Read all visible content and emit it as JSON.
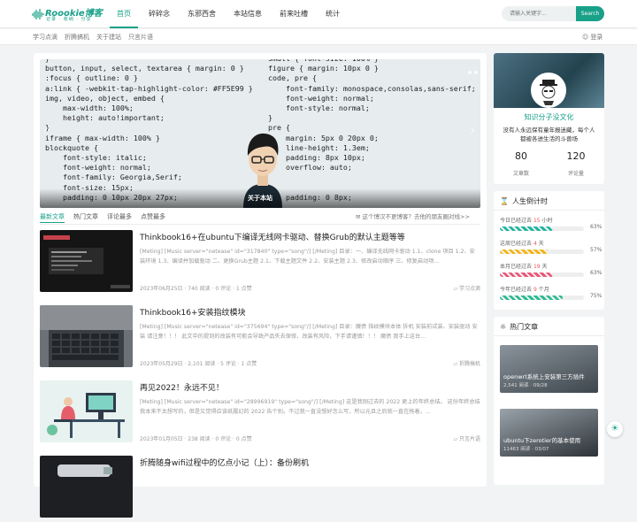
{
  "header": {
    "logo_text": "Roookie博客",
    "logo_slogan": "记录 · 收纳 · 分享",
    "nav": [
      "首页",
      "碎碎念",
      "东邪西舍",
      "本站信息",
      "前来吐槽",
      "统计"
    ],
    "search_placeholder": "请输入关键字...",
    "search_button": "Search"
  },
  "subnav": {
    "links": [
      "学习点滴",
      "折腾搞机",
      "关于建站",
      "只言片语"
    ],
    "login": "登录"
  },
  "hero": {
    "code_left": "}\nbutton, input, select, textarea { margin: 0 }\n:focus { outline: 0 }\na:link { -webkit-tap-highlight-color: #FF5E99 }\nimg, video, object, embed {\n    max-width: 100%;\n    height: auto!important;\n}\niframe { max-width: 100% }\nblockquote {\n    font-style: italic;\n    font-weight: normal;\n    font-family: Georgia,Serif;\n    font-size: 15px;\n    padding: 0 10px 20px 27px;",
    "code_right": "small { font-size: 100% }\nfigure { margin: 10px 0 }\ncode, pre {\n    font-family: monospace,consolas,sans-serif;\n    font-weight: normal;\n    font-style: normal;\n}\npre {\n    margin: 5px 0 20px 0;\n    line-height: 1.3em;\n    padding: 8px 10px;\n    overflow: auto;\n\n\n    padding: 0 8px;",
    "caption": "关于本站"
  },
  "tabs": [
    "最新文章",
    "热门文章",
    "评论最多",
    "点赞最多"
  ],
  "notice": "这个博汉不更博客？去他的朋友圈对线>>",
  "posts": [
    {
      "title": "Thinkbook16+在ubuntu下编译无线网卡驱动、替换Grub的默认主题等等",
      "excerpt": "[Meting] [Music server=\"netease\" id=\"317840\" type=\"song\"/] [/Meting] 目录：一、编译无线网卡驱动 1.1、clone 项目 1.2、安装环境 1.3、编译并加载驱动 二、更换Grub主题 2.1、下载主题文件 2.2、安装主题 2.3、修改启动顺序 三、修复启动项...",
      "date": "2023年06月25日",
      "views": "740 阅读",
      "comments": "0 评论",
      "likes": "1 点赞",
      "category": "学习点滴"
    },
    {
      "title": "Thinkbook16+安装指纹模块",
      "excerpt": "[Meting] [Music server=\"netease\" id=\"375694\" type=\"song\"/] [/Meting] 目录：魔债 指纹模块本体 拆机 安装前试装、安装驱动 安装 请注意！！！ 此文中的提到的改装有可能会导致产品失去保修，改装有风险，下手请谨慎！！！ 魔债 我手上这台...",
      "date": "2023年05月29日",
      "views": "2,101 阅读",
      "comments": "5 评论",
      "likes": "1 点赞",
      "category": "折腾搞机"
    },
    {
      "title": "再见2022！永远不见！",
      "excerpt": "[Meting] [Music server=\"netease\" id=\"28996919\" type=\"song\"/] [/Meting] 这是我刚过去的 2022 更上的年终总结。 这份年终总结我本来不太想写的，但是又觉得应该纸履幻的 2022 告个别。不过我一直没想好怎么写，所以元旦之后就一直在拖着，...",
      "date": "2023年01月05日",
      "views": "238 阅读",
      "comments": "0 评论",
      "likes": "0 点赞",
      "category": "只言片语"
    },
    {
      "title": "折腾随身wifi过程中的亿点小记（上）：备份刷机",
      "excerpt": "",
      "date": "",
      "views": "",
      "comments": "",
      "likes": "",
      "category": ""
    }
  ],
  "profile": {
    "name": "知识分子没文化",
    "desc": "没有人永远保有童年报迷藏，每个人都被各进生活的斗兽场",
    "articles": "80",
    "articles_label": "文章数",
    "comments": "120",
    "comments_label": "评论量"
  },
  "countdown": {
    "title": "人生倒计时",
    "items": [
      {
        "prefix": "今日已经过去",
        "value": "15",
        "unit": "小时",
        "pct_text": "63%",
        "pct": 63,
        "color": "#23b6a0"
      },
      {
        "prefix": "这周已经过去",
        "value": "4",
        "unit": "天",
        "pct_text": "57%",
        "pct": 57,
        "color": "#f2b51c"
      },
      {
        "prefix": "本月已经过去",
        "value": "19",
        "unit": "天",
        "pct_text": "63%",
        "pct": 63,
        "color": "#e9597a"
      },
      {
        "prefix": "今年已经过去",
        "value": "9",
        "unit": "个月",
        "pct_text": "75%",
        "pct": 75,
        "color": "#2fbb93"
      }
    ]
  },
  "hot": {
    "title": "热门文章",
    "items": [
      {
        "title": "openwrt系统上安装第三方插件",
        "meta": "2,541 阅读 · 09/28"
      },
      {
        "title": "ubuntu下zerotier的基本使用",
        "meta": "11463 阅读 · 03/07"
      }
    ]
  }
}
